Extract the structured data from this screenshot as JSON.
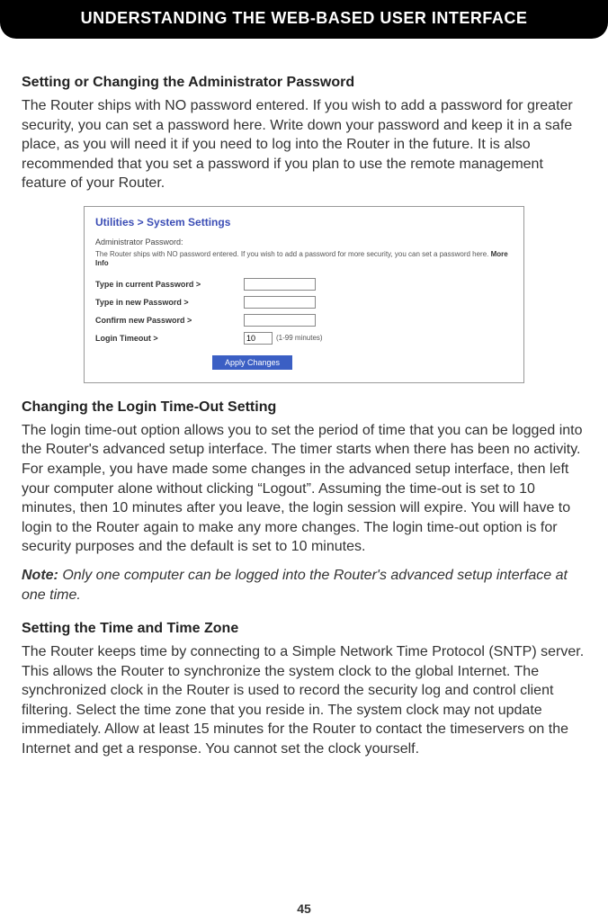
{
  "banner": "UNDERSTANDING THE WEB-BASED USER INTERFACE",
  "section1": {
    "heading": "Setting or Changing the Administrator Password",
    "body": "The Router ships with NO password entered. If you wish to add a password for greater security, you can set a password here. Write down your password and keep it in a safe place, as you will need it if you need to log into the Router in the future. It is also recommended that you set a password if you plan to use the remote management feature of your Router."
  },
  "figure": {
    "breadcrumb": "Utilities > System Settings",
    "subhead": "Administrator Password:",
    "desc_prefix": "The Router ships with NO password entered. If you wish to add a password for more security, you can set a password here. ",
    "desc_more": "More Info",
    "rows": {
      "current": "Type in current Password >",
      "new": "Type in new Password >",
      "confirm": "Confirm new Password >",
      "timeout": "Login Timeout >",
      "timeout_value": "10",
      "timeout_suffix": "(1-99 minutes)"
    },
    "button": "Apply Changes"
  },
  "section2": {
    "heading": "Changing the Login Time-Out Setting",
    "body": "The login time-out option allows you to set the period of time that you can be logged into the Router's advanced setup interface. The timer starts when there has been no activity. For example, you have made some changes in the advanced setup interface, then left your computer alone without clicking “Logout”. Assuming the time-out is set to 10 minutes, then 10 minutes after you leave, the login session will expire. You will have to login to the Router again to make any more changes. The login time-out option is for security purposes and the default is set to 10 minutes.",
    "note_label": "Note:",
    "note_body": " Only one computer can be logged into the Router's advanced setup interface at one time."
  },
  "section3": {
    "heading": "Setting the Time and Time Zone",
    "body": "The Router keeps time by connecting to a Simple Network Time Protocol (SNTP) server. This allows the Router to synchronize the system clock to the global Internet. The synchronized clock in the Router is used to record the security log and control client filtering. Select the time zone that you reside in. The system clock may not update immediately. Allow at least 15 minutes for the Router to contact the timeservers on the Internet and get a response. You cannot set the clock yourself."
  },
  "page_number": "45"
}
